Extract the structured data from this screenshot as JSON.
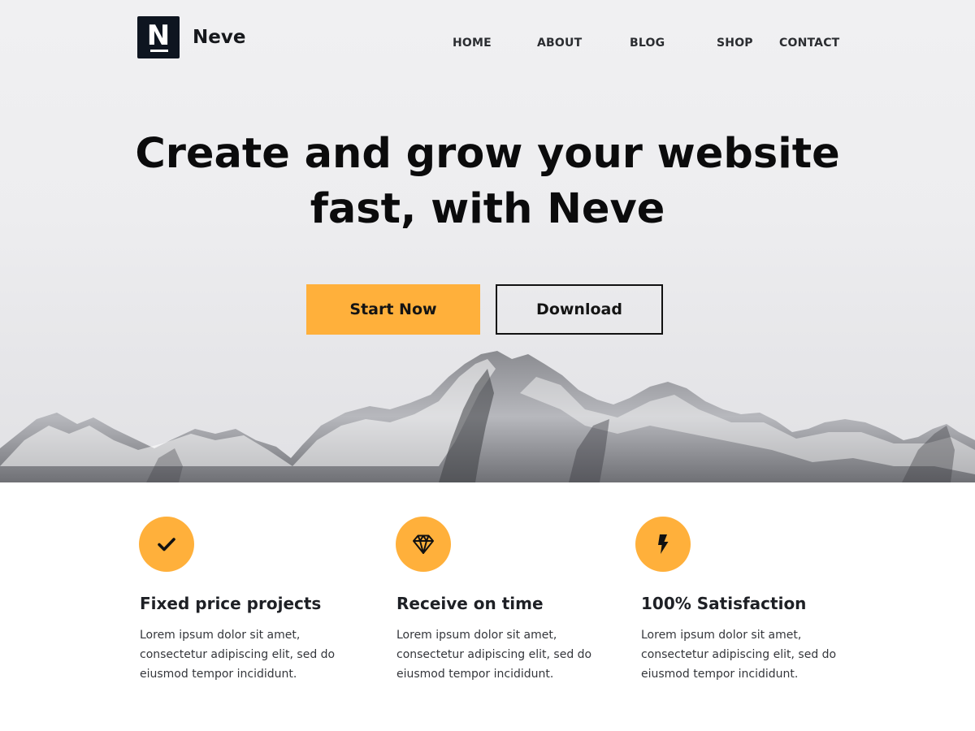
{
  "header": {
    "logo_letter": "N",
    "brand": "Neve",
    "nav": [
      {
        "label": "HOME"
      },
      {
        "label": "ABOUT"
      },
      {
        "label": "BLOG"
      },
      {
        "label": "SHOP"
      },
      {
        "label": "CONTACT"
      }
    ]
  },
  "hero": {
    "title_line1": "Create and grow your website",
    "title_line2": "fast, with Neve",
    "primary_button": "Start Now",
    "secondary_button": "Download"
  },
  "features": [
    {
      "icon": "checkmark-icon",
      "title": "Fixed price projects",
      "text_line1": "Lorem ipsum dolor sit amet,",
      "text_line2": "consectetur adipiscing elit, sed do",
      "text_line3": "eiusmod tempor incididunt."
    },
    {
      "icon": "diamond-icon",
      "title": "Receive on time",
      "text_line1": "Lorem ipsum dolor sit amet,",
      "text_line2": "consectetur adipiscing elit, sed do",
      "text_line3": "eiusmod tempor incididunt."
    },
    {
      "icon": "lightning-bolt-icon",
      "title": "100% Satisfaction",
      "text_line1": "Lorem ipsum dolor sit amet,",
      "text_line2": "consectetur adipiscing elit, sed do",
      "text_line3": "eiusmod tempor incididunt."
    }
  ],
  "colors": {
    "accent": "#ffb03b",
    "logo_bg": "#0e1520",
    "text_dark": "#0b0b0c",
    "hero_bg": "#eeeef0"
  }
}
